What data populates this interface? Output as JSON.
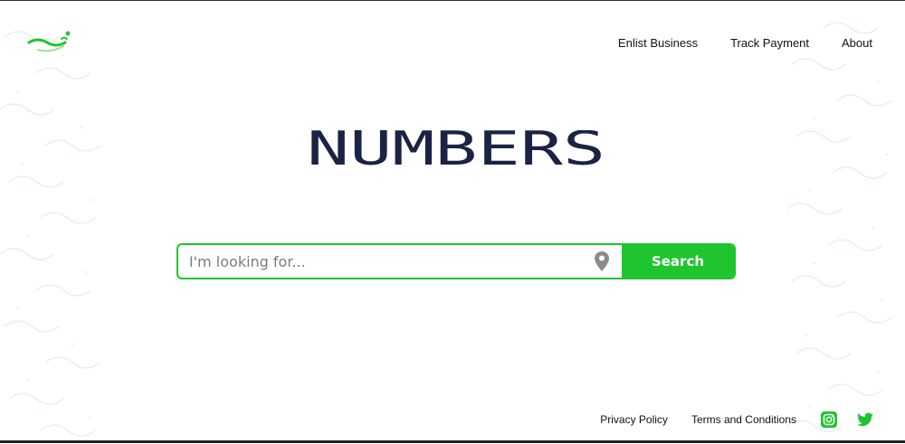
{
  "nav": {
    "enlist": "Enlist Business",
    "track": "Track Payment",
    "about": "About"
  },
  "brand": {
    "name": "NUMBERS"
  },
  "search": {
    "placeholder": "I'm looking for...",
    "button_label": "Search"
  },
  "footer": {
    "privacy": "Privacy Policy",
    "terms": "Terms and Conditions"
  },
  "icons": {
    "logo": "leaf-logo-icon",
    "location": "location-pin-icon",
    "instagram": "instagram-icon",
    "twitter": "twitter-icon"
  },
  "colors": {
    "accent": "#1ec52f",
    "brand_text": "#1b2344",
    "pin": "#8c8c8c"
  }
}
